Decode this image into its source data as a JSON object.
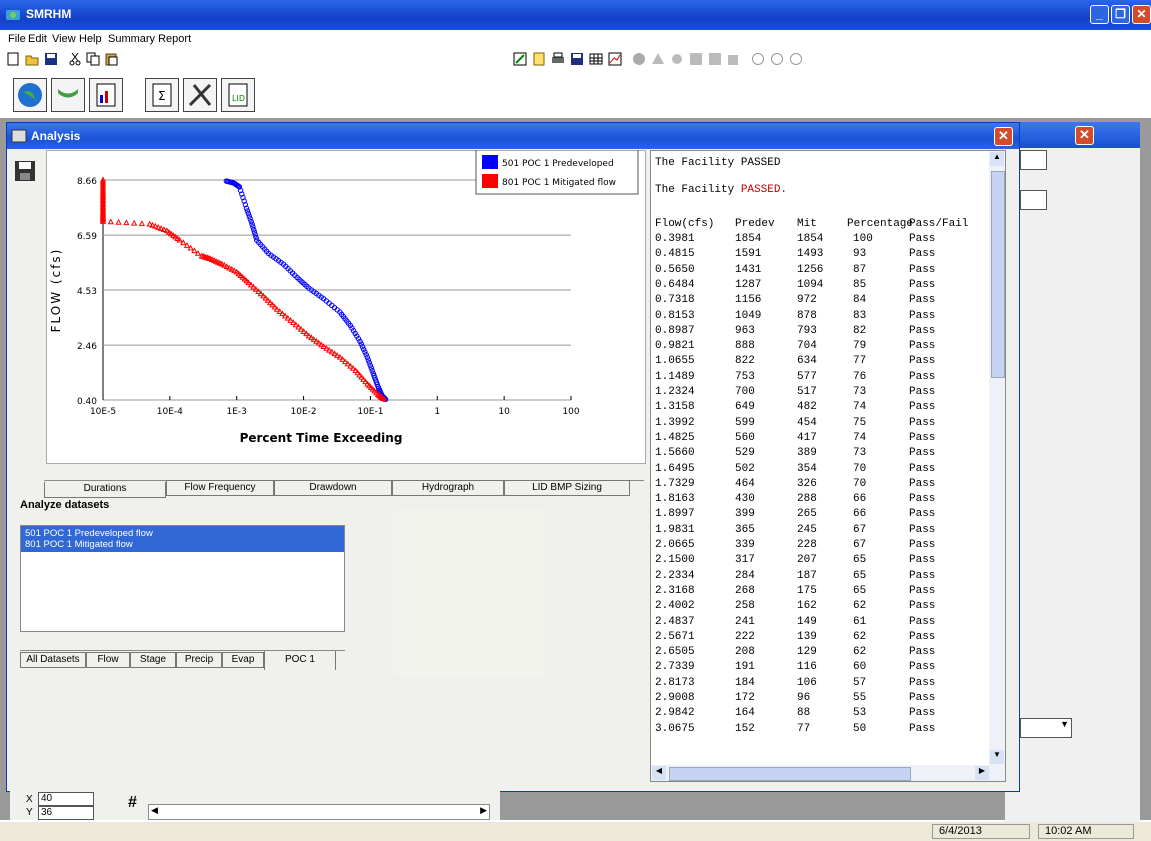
{
  "app": {
    "title": "SMRHM"
  },
  "menu": [
    "File",
    "Edit",
    "View",
    "Help",
    "Summary Report"
  ],
  "analysis_window": {
    "title": "Analysis"
  },
  "chart_data": {
    "type": "scatter",
    "title": "",
    "xlabel": "Percent Time Exceeding",
    "ylabel": "FLOW (cfs)",
    "x_scale": "log",
    "x_ticks": [
      "10E-5",
      "10E-4",
      "1E-3",
      "10E-2",
      "10E-1",
      "1",
      "10",
      "100"
    ],
    "y_ticks": [
      "8.66",
      "6.59",
      "4.53",
      "2.46",
      "0.40"
    ],
    "ylim": [
      0.4,
      8.66
    ],
    "xlim": [
      1e-05,
      100
    ],
    "legend_position": "top-right",
    "series": [
      {
        "name": "501 POC 1 Predeveloped",
        "color": "#0000ff",
        "points": [
          [
            0.0007,
            8.62
          ],
          [
            0.0009,
            8.55
          ],
          [
            0.0011,
            8.4
          ],
          [
            0.0014,
            7.6
          ],
          [
            0.0017,
            7.0
          ],
          [
            0.002,
            6.4
          ],
          [
            0.003,
            5.9
          ],
          [
            0.005,
            5.5
          ],
          [
            0.008,
            5.0
          ],
          [
            0.012,
            4.6
          ],
          [
            0.02,
            4.2
          ],
          [
            0.035,
            3.7
          ],
          [
            0.05,
            3.2
          ],
          [
            0.07,
            2.6
          ],
          [
            0.09,
            2.0
          ],
          [
            0.11,
            1.4
          ],
          [
            0.13,
            0.9
          ],
          [
            0.15,
            0.55
          ],
          [
            0.17,
            0.42
          ]
        ]
      },
      {
        "name": "801 POC 1 Mitigated flow",
        "color": "#ff0000",
        "points": [
          [
            1e-05,
            8.66
          ],
          [
            1e-05,
            8.2
          ],
          [
            1e-05,
            7.8
          ],
          [
            1e-05,
            7.4
          ],
          [
            1e-05,
            7.1
          ],
          [
            5e-05,
            7.0
          ],
          [
            9e-05,
            6.75
          ],
          [
            0.00014,
            6.4
          ],
          [
            0.0003,
            5.8
          ],
          [
            0.0004,
            5.7
          ],
          [
            0.0006,
            5.5
          ],
          [
            0.001,
            5.2
          ],
          [
            0.0015,
            4.8
          ],
          [
            0.0025,
            4.3
          ],
          [
            0.004,
            3.8
          ],
          [
            0.007,
            3.3
          ],
          [
            0.012,
            2.8
          ],
          [
            0.02,
            2.4
          ],
          [
            0.035,
            2.0
          ],
          [
            0.06,
            1.5
          ],
          [
            0.09,
            1.0
          ],
          [
            0.13,
            0.6
          ],
          [
            0.16,
            0.42
          ]
        ]
      }
    ]
  },
  "chart_tabs": [
    "Durations",
    "Flow Frequency",
    "Drawdown",
    "Hydrograph",
    "LID BMP Sizing"
  ],
  "datasets": {
    "heading": "Analyze datasets",
    "items": [
      "501 POC 1 Predeveloped flow",
      "801 POC 1 Mitigated flow"
    ],
    "tabs": [
      "All Datasets",
      "Flow",
      "Stage",
      "Precip",
      "Evap",
      "POC 1"
    ]
  },
  "report": {
    "line1": "The Facility PASSED",
    "line2_prefix": "The Facility ",
    "line2_status": "PASSED.",
    "headers": [
      "Flow(cfs)",
      "Predev",
      "Mit",
      "Percentage",
      "Pass/Fail"
    ],
    "rows": [
      [
        "0.3981",
        "1854",
        "1854",
        "100",
        "Pass"
      ],
      [
        "0.4815",
        "1591",
        "1493",
        "93",
        "Pass"
      ],
      [
        "0.5650",
        "1431",
        "1256",
        "87",
        "Pass"
      ],
      [
        "0.6484",
        "1287",
        "1094",
        "85",
        "Pass"
      ],
      [
        "0.7318",
        "1156",
        "972",
        "84",
        "Pass"
      ],
      [
        "0.8153",
        "1049",
        "878",
        "83",
        "Pass"
      ],
      [
        "0.8987",
        "963",
        "793",
        "82",
        "Pass"
      ],
      [
        "0.9821",
        "888",
        "704",
        "79",
        "Pass"
      ],
      [
        "1.0655",
        "822",
        "634",
        "77",
        "Pass"
      ],
      [
        "1.1489",
        "753",
        "577",
        "76",
        "Pass"
      ],
      [
        "1.2324",
        "700",
        "517",
        "73",
        "Pass"
      ],
      [
        "1.3158",
        "649",
        "482",
        "74",
        "Pass"
      ],
      [
        "1.3992",
        "599",
        "454",
        "75",
        "Pass"
      ],
      [
        "1.4825",
        "560",
        "417",
        "74",
        "Pass"
      ],
      [
        "1.5660",
        "529",
        "389",
        "73",
        "Pass"
      ],
      [
        "1.6495",
        "502",
        "354",
        "70",
        "Pass"
      ],
      [
        "1.7329",
        "464",
        "326",
        "70",
        "Pass"
      ],
      [
        "1.8163",
        "430",
        "288",
        "66",
        "Pass"
      ],
      [
        "1.8997",
        "399",
        "265",
        "66",
        "Pass"
      ],
      [
        "1.9831",
        "365",
        "245",
        "67",
        "Pass"
      ],
      [
        "2.0665",
        "339",
        "228",
        "67",
        "Pass"
      ],
      [
        "2.1500",
        "317",
        "207",
        "65",
        "Pass"
      ],
      [
        "2.2334",
        "284",
        "187",
        "65",
        "Pass"
      ],
      [
        "2.3168",
        "268",
        "175",
        "65",
        "Pass"
      ],
      [
        "2.4002",
        "258",
        "162",
        "62",
        "Pass"
      ],
      [
        "2.4837",
        "241",
        "149",
        "61",
        "Pass"
      ],
      [
        "2.5671",
        "222",
        "139",
        "62",
        "Pass"
      ],
      [
        "2.6505",
        "208",
        "129",
        "62",
        "Pass"
      ],
      [
        "2.7339",
        "191",
        "116",
        "60",
        "Pass"
      ],
      [
        "2.8173",
        "184",
        "106",
        "57",
        "Pass"
      ],
      [
        "2.9008",
        "172",
        "96",
        "55",
        "Pass"
      ],
      [
        "2.9842",
        "164",
        "88",
        "53",
        "Pass"
      ],
      [
        "3.0675",
        "152",
        "77",
        "50",
        "Pass"
      ]
    ]
  },
  "coords": {
    "x_label": "X",
    "x_value": "40",
    "y_label": "Y",
    "y_value": "36",
    "hash": "#"
  },
  "status": {
    "date": "6/4/2013",
    "time": "10:02 AM"
  },
  "colors": {
    "titlebar": "#1a4fd8",
    "pass_red": "#c00000",
    "selected": "#3168d5"
  }
}
